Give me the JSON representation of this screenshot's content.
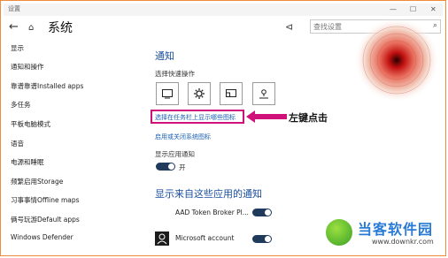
{
  "window": {
    "title": "设置",
    "minimize_glyph": "—",
    "maximize_glyph": "☐",
    "close_glyph": "✕"
  },
  "nav": {
    "back_glyph": "←",
    "home_glyph": "⌂",
    "title": "系统"
  },
  "search": {
    "placeholder": "查找设置",
    "icon": "search-icon"
  },
  "pin": {
    "icon": "pin-icon",
    "glyph": "⊲"
  },
  "sidebar": {
    "items": [
      {
        "label": "显示"
      },
      {
        "label": "通知和操作"
      },
      {
        "label": "靠谱靠谱Installed apps"
      },
      {
        "label": "多任务"
      },
      {
        "label": "平板电脑模式"
      },
      {
        "label": "语音"
      },
      {
        "label": "电源和睡眠"
      },
      {
        "label": "频繁启用Storage"
      },
      {
        "label": "习事事情Offline maps"
      },
      {
        "label": "俩号玩游Default apps"
      },
      {
        "label": "Windows Defender"
      }
    ]
  },
  "main": {
    "section_title": "通知",
    "quick_actions_label": "选择快速操作",
    "quick_actions": [
      {
        "icon": "tablet-mode-icon"
      },
      {
        "icon": "settings-gear-icon"
      },
      {
        "icon": "connect-icon"
      },
      {
        "icon": "location-icon"
      }
    ],
    "taskbar_icons_link": "选择在任务栏上显示哪些图标",
    "system_icons_link": "启用或关闭系统图标",
    "show_app_notifications_label": "显示应用通知",
    "show_app_notifications_state": "开",
    "apps_section_title": "显示来自这些应用的通知",
    "apps": [
      {
        "name": "AAD Token Broker Pl...",
        "enabled": true
      },
      {
        "name": "Microsoft account",
        "enabled": true
      }
    ]
  },
  "annotation": {
    "text": "左键点击",
    "color": "#d0117a"
  },
  "watermark": {
    "title": "当客软件园",
    "url": "www.downkr.com"
  },
  "colors": {
    "accent": "#1a4ea0",
    "link": "#1a5fb4",
    "toggle_on": "#1f3a5a",
    "highlight": "#d0117a",
    "frame": "#f08a3c"
  }
}
